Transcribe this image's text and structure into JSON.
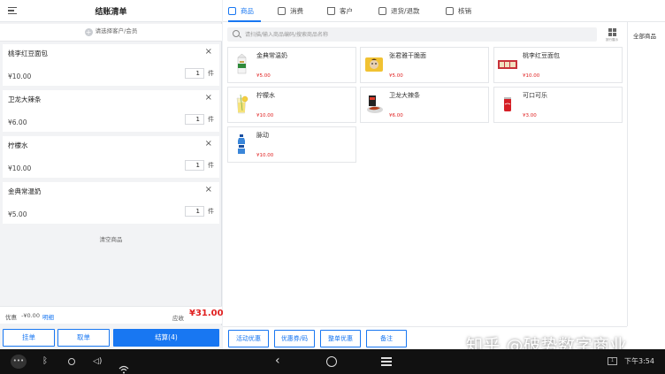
{
  "cart": {
    "title": "结账清单",
    "select_customer": "请选择客户/会员",
    "items": [
      {
        "name": "桃李红豆面包",
        "price": "¥10.00",
        "qty": "1",
        "unit": "件"
      },
      {
        "name": "卫龙大辣条",
        "price": "¥6.00",
        "qty": "1",
        "unit": "件"
      },
      {
        "name": "柠檬水",
        "price": "¥10.00",
        "qty": "1",
        "unit": "件"
      },
      {
        "name": "金典常温奶",
        "price": "¥5.00",
        "qty": "1",
        "unit": "件"
      }
    ],
    "clear_label": "清空商品",
    "discount_label": "优惠",
    "discount_value": "-¥0.00",
    "detail_link": "明细",
    "due_label": "应收",
    "due_value": "¥31.00",
    "hang_button": "挂单",
    "take_button": "取单",
    "checkout_button": "结算(4)"
  },
  "tabs": [
    {
      "label": "商品",
      "icon": "calendar-icon"
    },
    {
      "label": "消费",
      "icon": "bag-icon"
    },
    {
      "label": "客户",
      "icon": "crown-icon"
    },
    {
      "label": "退货/退款",
      "icon": "box-icon"
    },
    {
      "label": "核销",
      "icon": "document-icon"
    }
  ],
  "search": {
    "placeholder": "请扫描/输入商品编码/搜索商品名称"
  },
  "grid_toggle_label": "按行展示",
  "categories": {
    "all": "全部商品"
  },
  "products": [
    {
      "name": "金典常温奶",
      "price": "¥5.00",
      "thumb": "milk-carton"
    },
    {
      "name": "张君雅干脆面",
      "price": "¥5.00",
      "thumb": "noodle-pack"
    },
    {
      "name": "桃李红豆面包",
      "price": "¥10.00",
      "thumb": "bread-pack"
    },
    {
      "name": "柠檬水",
      "price": "¥10.00",
      "thumb": "lemonade-glass"
    },
    {
      "name": "卫龙大辣条",
      "price": "¥6.00",
      "thumb": "spicy-strip"
    },
    {
      "name": "可口可乐",
      "price": "¥3.00",
      "thumb": "cola-can"
    },
    {
      "name": "脉动",
      "price": "¥10.00",
      "thumb": "sports-drink"
    }
  ],
  "actions": {
    "promo": "活动优惠",
    "coupon": "优惠券/码",
    "whole_discount": "整单优惠",
    "remark": "备注"
  },
  "watermark": "知乎 @破势数字商业",
  "status": {
    "time": "下午3:54"
  },
  "colors": {
    "accent": "#1877f2",
    "price_red": "#e02020"
  }
}
